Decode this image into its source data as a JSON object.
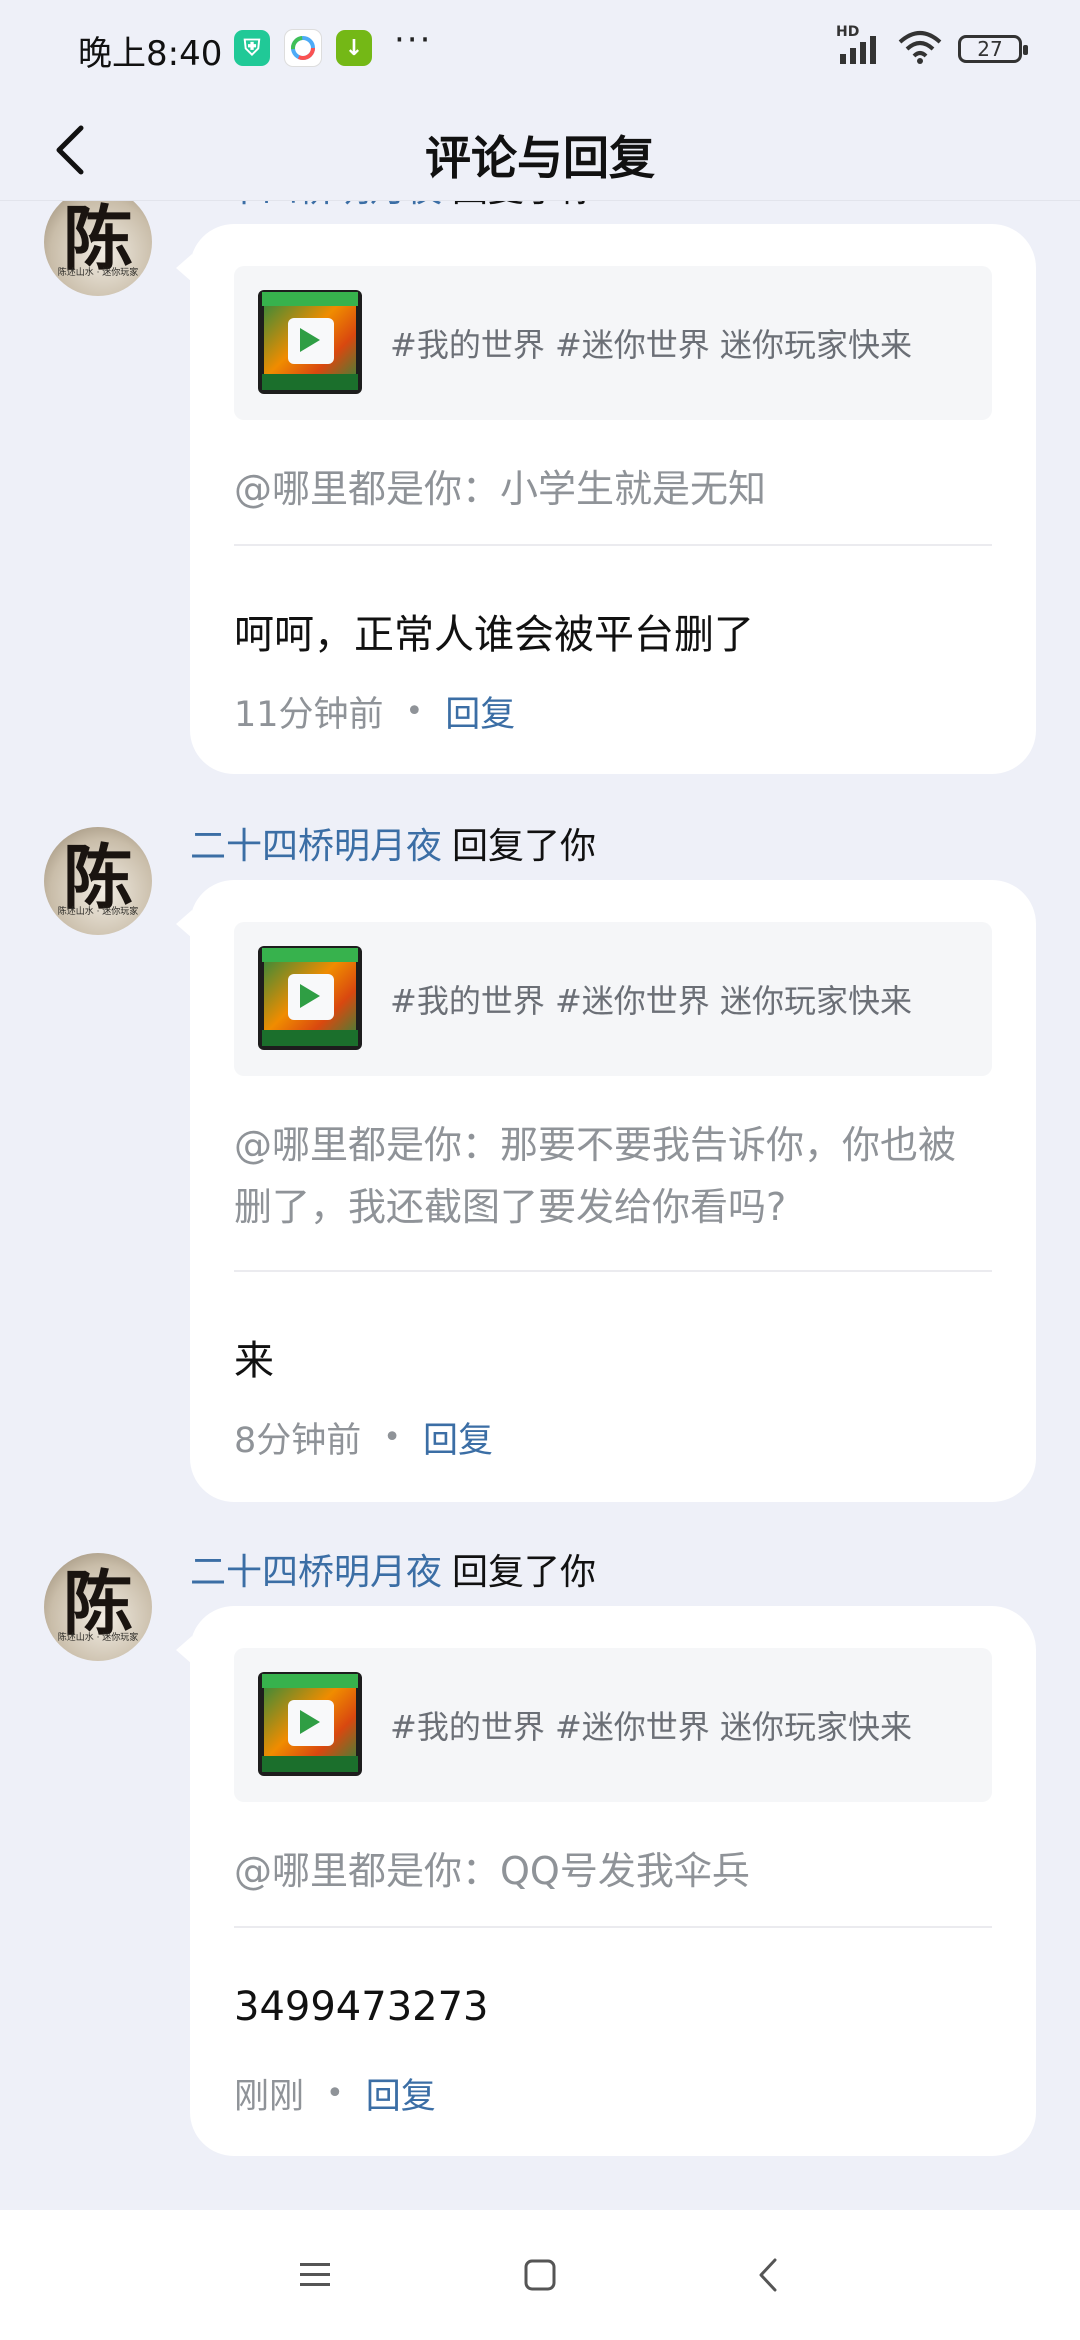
{
  "status_bar": {
    "time": "晚上8:40",
    "more": "···",
    "network": "HD",
    "battery": "27",
    "app_colors": [
      "#20c997",
      "#4dabf7",
      "#74b816"
    ]
  },
  "header": {
    "title": "评论与回复"
  },
  "items": [
    {
      "avatar_char": "陈",
      "avatar_caption": "陈述山水 · 迷你玩家",
      "user": "二十四桥明月夜",
      "action": "回复了你",
      "quote": "#我的世界 #迷你世界 迷你玩家快来",
      "reply_target": "@哪里都是你：小学生就是无知",
      "comment": "呵呵，正常人谁会被平台删了",
      "time": "11分钟前",
      "sep": "•",
      "reply_label": "回复"
    },
    {
      "avatar_char": "陈",
      "avatar_caption": "陈述山水 · 迷你玩家",
      "user": "二十四桥明月夜",
      "action": "回复了你",
      "quote": "#我的世界 #迷你世界 迷你玩家快来",
      "reply_target": "@哪里都是你：那要不要我告诉你，你也被删了，我还截图了要发给你看吗?",
      "comment": "来",
      "time": "8分钟前",
      "sep": "•",
      "reply_label": "回复"
    },
    {
      "avatar_char": "陈",
      "avatar_caption": "陈述山水 · 迷你玩家",
      "user": "二十四桥明月夜",
      "action": "回复了你",
      "quote": "#我的世界 #迷你世界 迷你玩家快来",
      "reply_target": "@哪里都是你：QQ号发我伞兵",
      "comment": "3499473273",
      "time": "刚刚",
      "sep": "•",
      "reply_label": "回复"
    }
  ]
}
